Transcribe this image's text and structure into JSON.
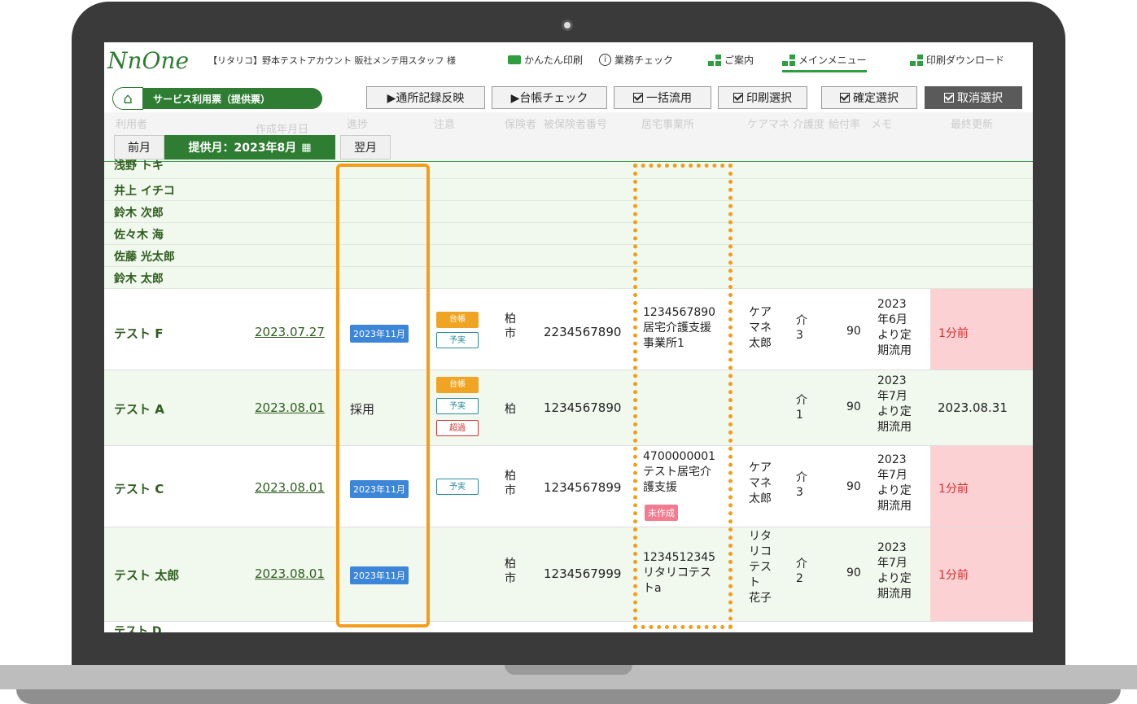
{
  "header": {
    "logo": "NnOne",
    "account": "【リタリコ】野本テストアカウント 販社メンテ用スタッフ 様",
    "links": {
      "easy_print": "かんたん印刷",
      "task_check": "業務チェック",
      "guide": "ご案内",
      "main_menu": "メインメニュー",
      "print_download": "印刷ダウンロード"
    }
  },
  "toolbar": {
    "service_ticket": "サービス利用票（提供票）",
    "buttons": {
      "reflect": "▶通所記録反映",
      "ledger_check": "▶台帳チェック",
      "bulk": "一括流用",
      "print_select": "印刷選択",
      "confirm_select": "確定選択",
      "cancel_select": "取消選択"
    }
  },
  "columns": [
    "利用者",
    "作成年月日",
    "進捗",
    "注意",
    "保険者",
    "被保険者番号",
    "居宅事業所",
    "ケアマネ",
    "介護度",
    "給付率",
    "メモ",
    "最終更新"
  ],
  "month_nav": {
    "prev": "前月",
    "current": "提供月：2023年8月",
    "next": "翌月"
  },
  "name_only_rows": [
    "浅野 トキ",
    "井上 イチコ",
    "鈴木 次郎",
    "佐々木 海",
    "佐藤 光太郎",
    "鈴木 太郎"
  ],
  "rows": [
    {
      "name": "テスト F",
      "date": "2023.07.27",
      "progress": "2023年11月",
      "tags": [
        "台帳",
        "予実"
      ],
      "insurer": "柏\n市",
      "number": "2234567890",
      "office": [
        "1234567890",
        "居宅介護支援",
        "事業所1"
      ],
      "caremgr": [
        "ケア",
        "マネ",
        "太郎"
      ],
      "level": [
        "介",
        "3"
      ],
      "rate": "90",
      "memo": [
        "2023",
        "年6月",
        "より定",
        "期流用"
      ],
      "updated": "1分前"
    },
    {
      "name": "テスト A",
      "date": "2023.08.01",
      "progress": "採用",
      "tags": [
        "台帳",
        "予実",
        "超過"
      ],
      "insurer": "柏",
      "number": "1234567890",
      "office": [],
      "caremgr": [],
      "level": [
        "介",
        "1"
      ],
      "rate": "90",
      "memo": [
        "2023",
        "年7月",
        "より定",
        "期流用"
      ],
      "updated": "2023.08.31"
    },
    {
      "name": "テスト C",
      "date": "2023.08.01",
      "progress": "2023年11月",
      "tags": [
        "予実"
      ],
      "insurer": "柏\n市",
      "number": "1234567899",
      "office": [
        "4700000001",
        "テスト居宅介",
        "護支援"
      ],
      "office_badge": "未作成",
      "caremgr": [
        "ケア",
        "マネ",
        "太郎"
      ],
      "level": [
        "介",
        "3"
      ],
      "rate": "90",
      "memo": [
        "2023",
        "年7月",
        "より定",
        "期流用"
      ],
      "updated": "1分前"
    },
    {
      "name": "テスト 太郎",
      "date": "2023.08.01",
      "progress": "2023年11月",
      "tags": [],
      "insurer": "柏\n市",
      "number": "1234567999",
      "office": [
        "1234512345",
        "リタリコテス",
        "トa"
      ],
      "caremgr": [
        "リタ",
        "リコ",
        "テス",
        "ト",
        "花子"
      ],
      "level": [
        "介",
        "2"
      ],
      "rate": "90",
      "memo": [
        "2023",
        "年7月",
        "より定",
        "期流用"
      ],
      "updated": "1分前"
    }
  ],
  "cutoff_row": "テスト D",
  "colors": {
    "brand_green": "#2e7d32",
    "highlight_orange": "#f59c1a",
    "late_pink": "#fbd1d3",
    "badge_blue": "#3d85d6"
  }
}
